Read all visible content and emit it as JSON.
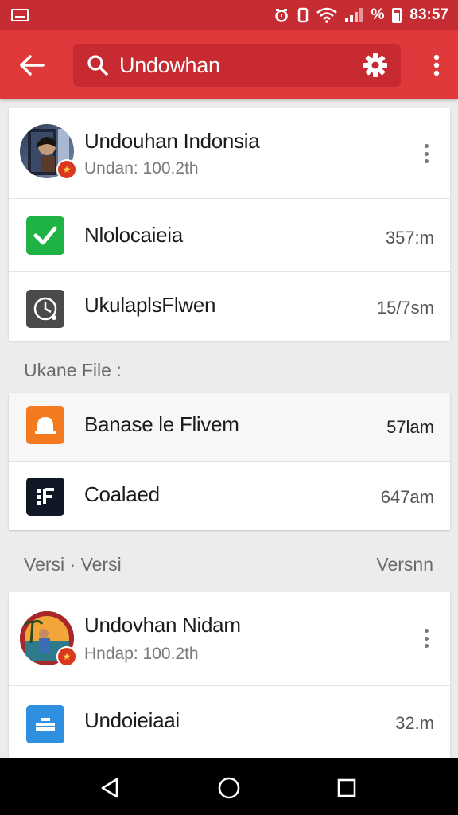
{
  "status_bar": {
    "notification_icon": "notification-icon",
    "battery_percent_label": "%",
    "time": "83:57",
    "colors": {
      "background": "#c62d33"
    }
  },
  "toolbar": {
    "search_value": "Undowhan",
    "back_icon": "arrow-left-icon",
    "search_icon": "search-icon",
    "settings_icon": "gear-icon",
    "overflow_icon": "more-vert-icon",
    "colors": {
      "background": "#e0393c",
      "search_bg": "#c72a30"
    }
  },
  "group1": [
    {
      "title": "Undouhan Indonsia",
      "subtitle": "Undan: 100.2th",
      "icon": "avatar-photo"
    },
    {
      "title": "Nlolocaieia",
      "size": "357:m",
      "icon": "green-check-icon"
    },
    {
      "title": "UkulaplsFlwen",
      "size": "15/7sm",
      "icon": "dark-clock-icon"
    }
  ],
  "section1": {
    "label": "Ukane File  :"
  },
  "group2": [
    {
      "title": "Banase le Flivem",
      "size": "57lam",
      "icon": "orange-bell-icon"
    },
    {
      "title": "Coalaed",
      "size": "647am",
      "icon": "dark-file-icon"
    }
  ],
  "section2": {
    "left_label": "Versi · Versi",
    "right_label": "Versnn"
  },
  "group3": [
    {
      "title": "Undovhan Nidam",
      "subtitle": "Hndap: 100.2th",
      "icon": "avatar-photo"
    },
    {
      "title": "Undoieiaai",
      "size": "32.m",
      "icon": "blue-doc-icon"
    }
  ],
  "nav": {
    "back": "triangle-back-icon",
    "home": "circle-home-icon",
    "recents": "square-recents-icon"
  }
}
